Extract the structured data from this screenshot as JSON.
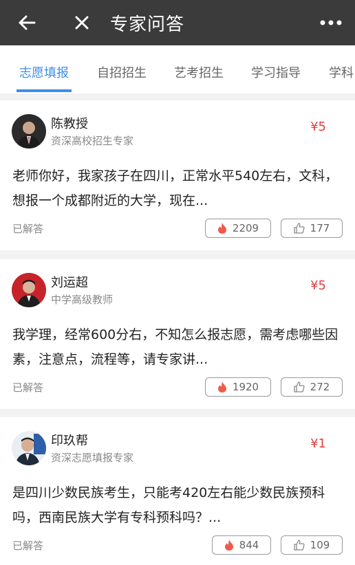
{
  "header": {
    "title": "专家问答",
    "icons": {
      "back": "arrow-left-icon",
      "close": "close-icon",
      "more": "more-dots-icon"
    }
  },
  "tabs": [
    {
      "label": "志愿填报",
      "active": true
    },
    {
      "label": "自招招生",
      "active": false
    },
    {
      "label": "艺考招生",
      "active": false
    },
    {
      "label": "学习指导",
      "active": false
    },
    {
      "label": "学科",
      "active": false
    }
  ],
  "questions": [
    {
      "name": "陈教授",
      "title": "资深高校招生专家",
      "price": "¥5",
      "text": "老师你好，我家孩子在四川，正常水平540左右，文科，想报一个成都附近的大学，现在...",
      "status": "已解答",
      "hot_count": "2209",
      "like_count": "177"
    },
    {
      "name": "刘运超",
      "title": "中学高级教师",
      "price": "¥5",
      "text": "我学理，经常600分右，不知怎么报志愿，需考虑哪些因素，注意点，流程等，请专家讲...",
      "status": "已解答",
      "hot_count": "1920",
      "like_count": "272"
    },
    {
      "name": "印玖帮",
      "title": "资深志愿填报专家",
      "price": "¥1",
      "text": "是四川少数民族考生，只能考420左右能少数民族预科吗，西南民族大学有专科预科吗？...",
      "status": "已解答",
      "hot_count": "844",
      "like_count": "109"
    }
  ],
  "colors": {
    "topbar": "#3b3b3b",
    "accent": "#3c8ee8",
    "price": "#e43d3d",
    "hot_icon": "#ef5a4a"
  }
}
